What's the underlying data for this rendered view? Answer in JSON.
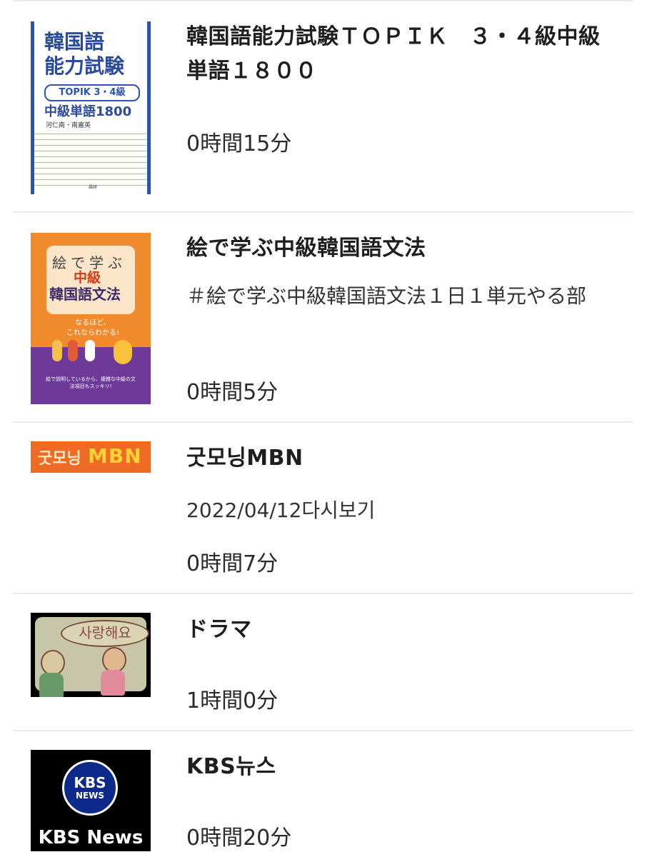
{
  "items": [
    {
      "title": "韓国語能力試験ＴＯＰＩＫ　３・４級中級単語１８００",
      "description": "",
      "duration": "0時間15分",
      "thumbnail": {
        "title_line1": "韓国語",
        "title_line2": "能力試験",
        "band": "TOPIK 3・4級",
        "subtitle": "中級単語1800",
        "authors": "河仁南・南嘉英",
        "publisher": "語研",
        "accent": "#2a54b0"
      }
    },
    {
      "title": "絵で学ぶ中級韓国語文法",
      "description": "＃絵で学ぶ中級韓国語文法１日１単元やる部",
      "duration": "0時間5分",
      "thumbnail": {
        "line1": "絵で学ぶ",
        "line2": "中級",
        "line3": "韓国語文法",
        "tagline_1": "なるほど、",
        "tagline_2": "これならわかる!",
        "note": "絵で説明しているから、複雑な中級の文法項目もスッキリ!",
        "accent": "#f08a2c",
        "secondary": "#6e3a9a"
      }
    },
    {
      "title": "굿모닝MBN",
      "description": "2022/04/12다시보기",
      "duration": "0時間7分",
      "thumbnail": {
        "ko": "굿모닝",
        "en": "MBN",
        "accent": "#ef6a22"
      }
    },
    {
      "title": "ドラマ",
      "description": "",
      "duration": "1時間0分",
      "thumbnail": {
        "speech": "사랑해요"
      }
    },
    {
      "title": "KBS뉴스",
      "description": "",
      "duration": "0時間20分",
      "thumbnail": {
        "circle_1": "KBS",
        "circle_2": "NEWS",
        "label": "KBS News",
        "accent": "#0d2a8a"
      }
    }
  ]
}
